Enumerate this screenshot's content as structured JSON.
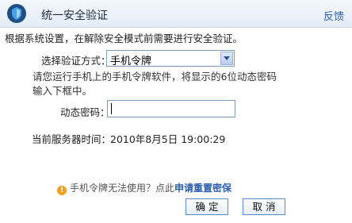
{
  "header": {
    "title": "统一安全验证",
    "feedback_link": "反馈"
  },
  "intro": "根据系统设置，在解除安全模式前需要进行安全验证。",
  "method": {
    "label": "选择验证方式：",
    "selected": "手机令牌"
  },
  "instruction": "请您运行手机上的手机令牌软件，将显示的6位动态密码输入下框中。",
  "code": {
    "label": "动态密码：",
    "value": ""
  },
  "server_time": {
    "label": "当前服务器时间：",
    "value": "2010年8月5日  19:00:29"
  },
  "hint": {
    "text": "手机令牌无法使用？点此",
    "link": "申请重置密保"
  },
  "buttons": {
    "ok": "确 定",
    "cancel": "取 消"
  },
  "colors": {
    "link": "#2a5db0",
    "border": "#7f9db9",
    "header_bg": "#e3ecf6"
  }
}
